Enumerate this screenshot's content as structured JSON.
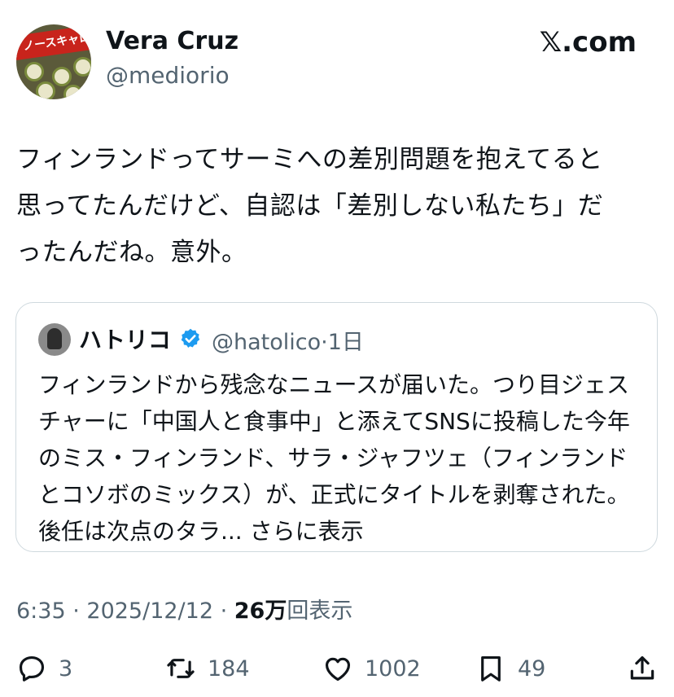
{
  "author": {
    "name": "Vera Cruz",
    "handle": "@mediorio",
    "avatar_text": "ノースキャロライ"
  },
  "source": "𝕏.com",
  "tweet": {
    "text_lines": [
      "フィンランドってサーミへの差別問題を抱えてると",
      "思ってたんだけど、自認は「差別しない私たち」だ",
      "ったんだね。意外。"
    ]
  },
  "quote": {
    "name": "ハトリコ",
    "handle": "@hatolico",
    "time": "·1日",
    "verified_color": "#1d9bf0",
    "text": "フィンランドから残念なニュースが届いた。つり目ジェスチャーに「中国人と食事中」と添えてSNSに投稿した今年のミス・フィンランド、サラ・ジャフツェ（フィンランドとコソボのミックス）が、正式にタイトルを剥奪された。後任は次点のタラ...",
    "more": "さらに表示"
  },
  "meta": {
    "time": "6:35",
    "date": "2025/12/12",
    "separator": " · ",
    "views_count": "26万",
    "views_label": "回表示"
  },
  "actions": {
    "reply_count": "3",
    "retweet_count": "184",
    "like_count": "1002",
    "bookmark_count": "49"
  },
  "icons": [
    "reply-icon",
    "retweet-icon",
    "like-icon",
    "bookmark-icon",
    "share-icon",
    "verified-icon"
  ]
}
